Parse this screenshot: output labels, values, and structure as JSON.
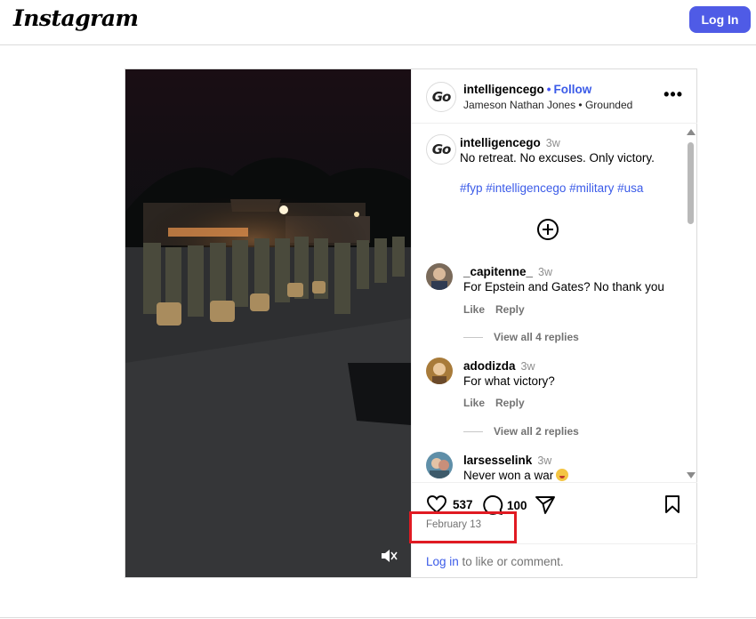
{
  "app": {
    "logo_text": "Instagram",
    "login_button": "Log In"
  },
  "post": {
    "username": "intelligencego",
    "follow_label": "Follow",
    "subtitle": "Jameson Nathan Jones • Grounded",
    "more_label": "•••",
    "avatar_text": "Go",
    "caption": {
      "username": "intelligencego",
      "time": "3w",
      "text": "No retreat. No excuses. Only victory.",
      "hashtags": "#fyp #intelligencego #military #usa"
    },
    "comments": [
      {
        "username": "_capitenne_",
        "time": "3w",
        "text": "For Epstein and Gates? No thank you",
        "like": "Like",
        "reply": "Reply",
        "replies": "View all 4 replies"
      },
      {
        "username": "adodizda",
        "time": "3w",
        "text": "For what victory?",
        "like": "Like",
        "reply": "Reply",
        "replies": "View all 2 replies"
      },
      {
        "username": "larsesselink",
        "time": "3w",
        "text": "Never won a war"
      }
    ],
    "likes_count": "537",
    "comments_count": "100",
    "date": "February 13",
    "login_link": "Log in",
    "login_suffix": " to like or comment."
  },
  "colors": {
    "accent": "#4f5be6",
    "link": "#3b5be8",
    "highlight": "#e01a22"
  },
  "icons": [
    "heart-icon",
    "comment-icon",
    "share-icon",
    "bookmark-icon",
    "mute-icon",
    "add-icon"
  ]
}
